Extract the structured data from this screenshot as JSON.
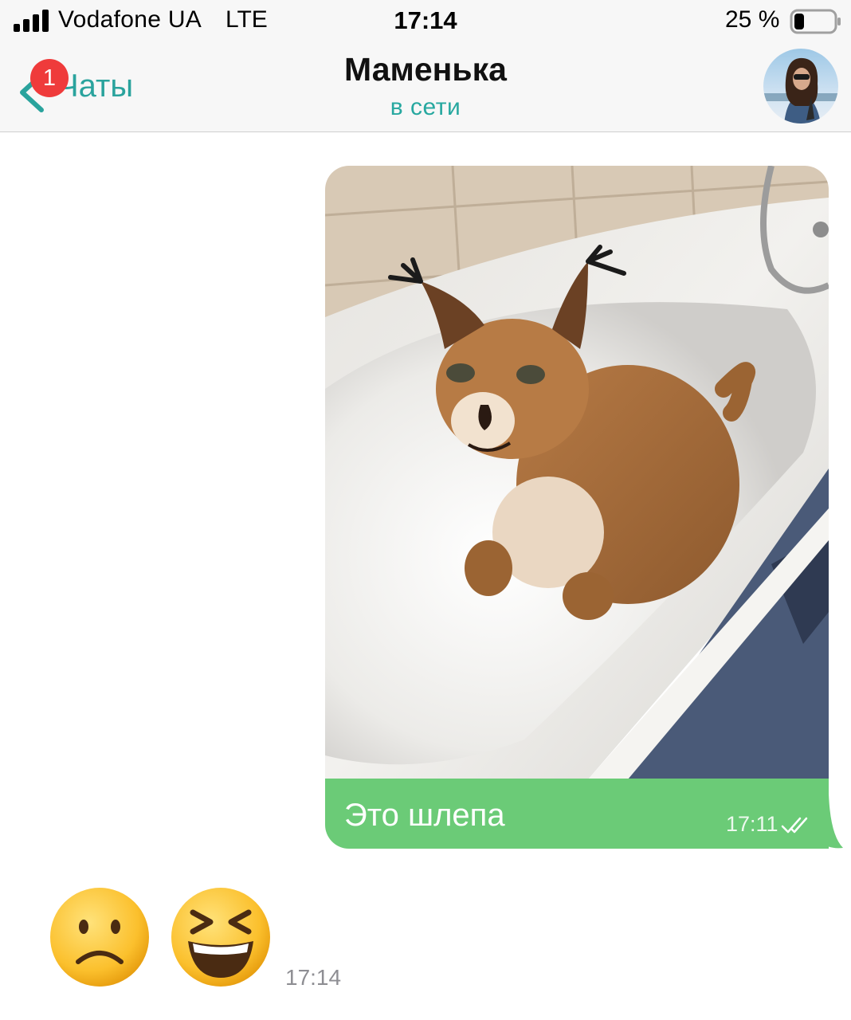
{
  "status_bar": {
    "carrier": "Vodafone UA",
    "network": "LTE",
    "time": "17:14",
    "battery": "25 %",
    "battery_level": 0.25,
    "signal_icon": "signal-bars-icon",
    "battery_icon": "battery-icon"
  },
  "header": {
    "back_label": "Чаты",
    "unread_count": "1",
    "contact_name": "Маменька",
    "contact_status": "в сети",
    "back_icon": "chevron-left-icon",
    "avatar_icon": "contact-avatar-photo"
  },
  "messages": {
    "outgoing": {
      "photo": "caracal-in-bathtub-photo",
      "text": "Это шлепа",
      "time": "17:11",
      "status_icon": "double-check-icon"
    },
    "incoming": {
      "emojis": [
        "slightly-frowning-face-emoji",
        "grinning-squinting-face-emoji"
      ],
      "time": "17:14"
    }
  },
  "colors": {
    "accent": "#2aa39d",
    "outgoing_bubble": "#6bcb77",
    "badge": "#ef3b3b",
    "header_bg": "#f7f7f7"
  }
}
